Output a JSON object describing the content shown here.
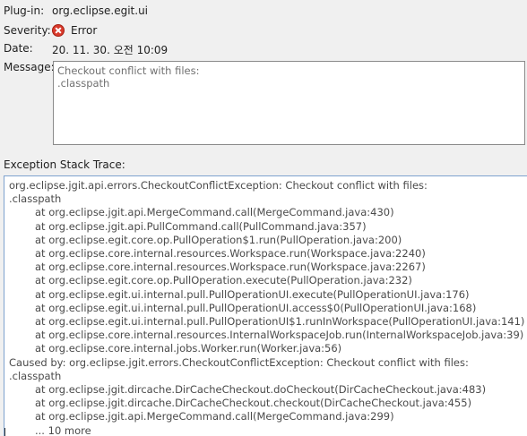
{
  "fields": {
    "plugin_label": "Plug-in:",
    "plugin_value": "org.eclipse.egit.ui",
    "severity_label": "Severity:",
    "severity_value": "Error",
    "severity_icon": "error-icon",
    "date_label": "Date:",
    "date_value": "20. 11. 30. 오전 10:09",
    "message_label": "Message:",
    "message_value": "Checkout conflict with files:\n.classpath"
  },
  "stack": {
    "label": "Exception Stack Trace:",
    "lines": [
      {
        "text": "org.eclipse.jgit.api.errors.CheckoutConflictException: Checkout conflict with files:",
        "indent": false
      },
      {
        "text": ".classpath",
        "indent": false
      },
      {
        "text": "at org.eclipse.jgit.api.MergeCommand.call(MergeCommand.java:430)",
        "indent": true
      },
      {
        "text": "at org.eclipse.jgit.api.PullCommand.call(PullCommand.java:357)",
        "indent": true
      },
      {
        "text": "at org.eclipse.egit.core.op.PullOperation$1.run(PullOperation.java:200)",
        "indent": true
      },
      {
        "text": "at org.eclipse.core.internal.resources.Workspace.run(Workspace.java:2240)",
        "indent": true
      },
      {
        "text": "at org.eclipse.core.internal.resources.Workspace.run(Workspace.java:2267)",
        "indent": true
      },
      {
        "text": "at org.eclipse.egit.core.op.PullOperation.execute(PullOperation.java:232)",
        "indent": true
      },
      {
        "text": "at org.eclipse.egit.ui.internal.pull.PullOperationUI.execute(PullOperationUI.java:176)",
        "indent": true
      },
      {
        "text": "at org.eclipse.egit.ui.internal.pull.PullOperationUI.access$0(PullOperationUI.java:168)",
        "indent": true
      },
      {
        "text": "at org.eclipse.egit.ui.internal.pull.PullOperationUI$1.runInWorkspace(PullOperationUI.java:141)",
        "indent": true
      },
      {
        "text": "at org.eclipse.core.internal.resources.InternalWorkspaceJob.run(InternalWorkspaceJob.java:39)",
        "indent": true
      },
      {
        "text": "at org.eclipse.core.internal.jobs.Worker.run(Worker.java:56)",
        "indent": true
      },
      {
        "text": "Caused by: org.eclipse.jgit.errors.CheckoutConflictException: Checkout conflict with files:",
        "indent": false
      },
      {
        "text": ".classpath",
        "indent": false
      },
      {
        "text": "at org.eclipse.jgit.dircache.DirCacheCheckout.doCheckout(DirCacheCheckout.java:483)",
        "indent": true
      },
      {
        "text": "at org.eclipse.jgit.dircache.DirCacheCheckout.checkout(DirCacheCheckout.java:455)",
        "indent": true
      },
      {
        "text": "at org.eclipse.jgit.api.MergeCommand.call(MergeCommand.java:299)",
        "indent": true
      },
      {
        "text": "... 10 more",
        "indent": true
      }
    ]
  },
  "colors": {
    "background": "#f0f0f0",
    "field_border": "#8a8a8a",
    "trace_focus_border": "#7da2ce",
    "error_icon": "#d93a2c"
  }
}
